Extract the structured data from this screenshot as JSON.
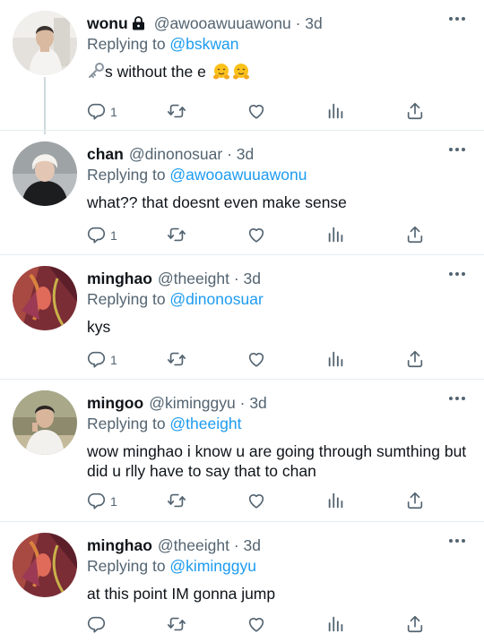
{
  "tweets": [
    {
      "display_name": "wonu",
      "handle": "@awooawuuawonu",
      "separator": "·",
      "time": "3d",
      "replying_prefix": "Replying to ",
      "replying_to": "@bskwan",
      "text": "s without the e",
      "reply_count": "1",
      "locked": true,
      "emoji": [
        "hugging-face-emoji",
        "hugging-face-emoji"
      ]
    },
    {
      "display_name": "chan",
      "handle": "@dinonosuar",
      "separator": "·",
      "time": "3d",
      "replying_prefix": "Replying to ",
      "replying_to": "@awooawuuawonu",
      "text": "what?? that doesnt even make sense",
      "reply_count": "1"
    },
    {
      "display_name": "minghao",
      "handle": "@theeight",
      "separator": "·",
      "time": "3d",
      "replying_prefix": "Replying to ",
      "replying_to": "@dinonosuar",
      "text": "kys",
      "reply_count": "1"
    },
    {
      "display_name": "mingoo",
      "handle": "@kiminggyu",
      "separator": "·",
      "time": "3d",
      "replying_prefix": "Replying to ",
      "replying_to": "@theeight",
      "text": "wow minghao i know u are going through sumthing but did u rlly have to say that to chan",
      "reply_count": "1"
    },
    {
      "display_name": "minghao",
      "handle": "@theeight",
      "separator": "·",
      "time": "3d",
      "replying_prefix": "Replying to ",
      "replying_to": "@kiminggyu",
      "text": "at this point IM gonna jump",
      "reply_count": ""
    }
  ],
  "icons": {
    "more": "more-horizontal-icon",
    "reply": "reply-icon",
    "retweet": "retweet-icon",
    "like": "heart-icon",
    "views": "analytics-icon",
    "share": "share-icon",
    "lock": "lock-icon",
    "key": "key-emoji"
  },
  "colors": {
    "text": "#0f1419",
    "secondary": "#536471",
    "link": "#1d9bf0",
    "divider": "#e6ecf0",
    "thread_line": "#cfd9de"
  }
}
